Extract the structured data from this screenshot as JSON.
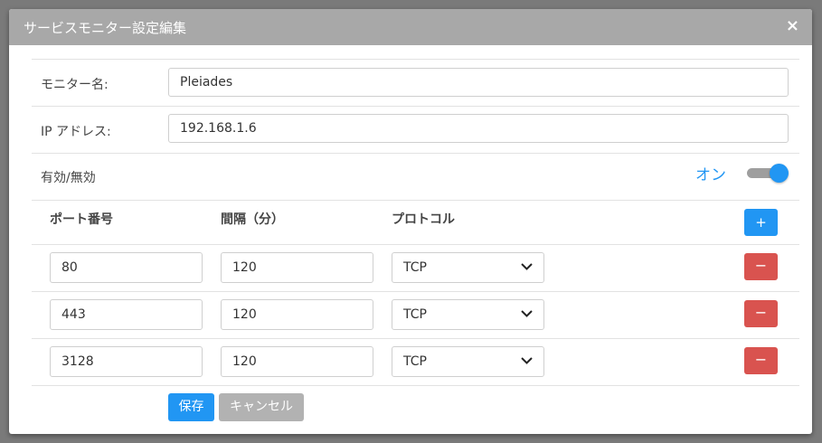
{
  "dialog": {
    "title": "サービスモニター設定編集",
    "close_symbol": "×"
  },
  "form": {
    "monitor_name": {
      "label": "モニター名:",
      "value": "Pleiades"
    },
    "ip_address": {
      "label": "IP アドレス:",
      "value": "192.168.1.6"
    },
    "enabled": {
      "label": "有効/無効",
      "state_label": "オン",
      "on": true
    }
  },
  "ports": {
    "headers": {
      "port": "ポート番号",
      "interval": "間隔（分）",
      "protocol": "プロトコル"
    },
    "add_label": "+",
    "remove_label": "−",
    "rows": [
      {
        "port": "80",
        "interval": "120",
        "protocol": "TCP"
      },
      {
        "port": "443",
        "interval": "120",
        "protocol": "TCP"
      },
      {
        "port": "3128",
        "interval": "120",
        "protocol": "TCP"
      }
    ]
  },
  "actions": {
    "save_label": "保存",
    "cancel_label": "キャンセル"
  },
  "colors": {
    "accent": "#2196f3",
    "danger": "#d9534f",
    "titlebar": "#a8a8a8",
    "cancel": "#b2b2b2"
  }
}
